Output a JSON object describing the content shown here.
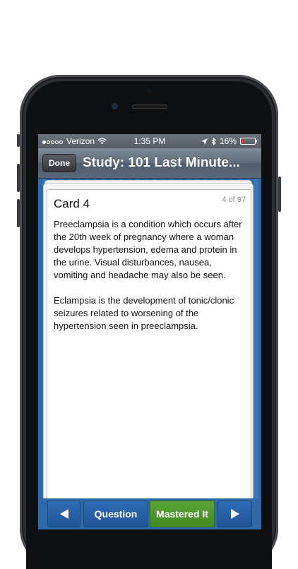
{
  "status_bar": {
    "carrier": "Verizon",
    "time": "1:35 PM",
    "battery": "16%",
    "battery_level": 0.16
  },
  "nav": {
    "done_label": "Done",
    "title": "Study: 101 Last Minute..."
  },
  "card": {
    "title": "Card 4",
    "counter": "4 of 97",
    "paragraphs": [
      "Preeclampsia is a condition which occurs after the 20th week of pregnancy where a woman develops hypertension, edema and protein in the urine. Visual disturbances, nausea, vomiting and headache may also be seen.",
      "Eclampsia is the development of tonic/clonic seizures related to worsening of the hypertension seen in preeclampsia."
    ]
  },
  "toolbar": {
    "question_label": "Question",
    "mastered_label": "Mastered It"
  },
  "icons": {
    "prev": "triangle-left-icon",
    "next": "triangle-right-icon",
    "wifi": "wifi-icon",
    "location": "location-arrow-icon",
    "bluetooth": "bluetooth-icon",
    "battery": "battery-icon"
  },
  "colors": {
    "blue_button": "#1f5597",
    "green_button": "#418a22",
    "battery_low": "#e23b3b"
  }
}
